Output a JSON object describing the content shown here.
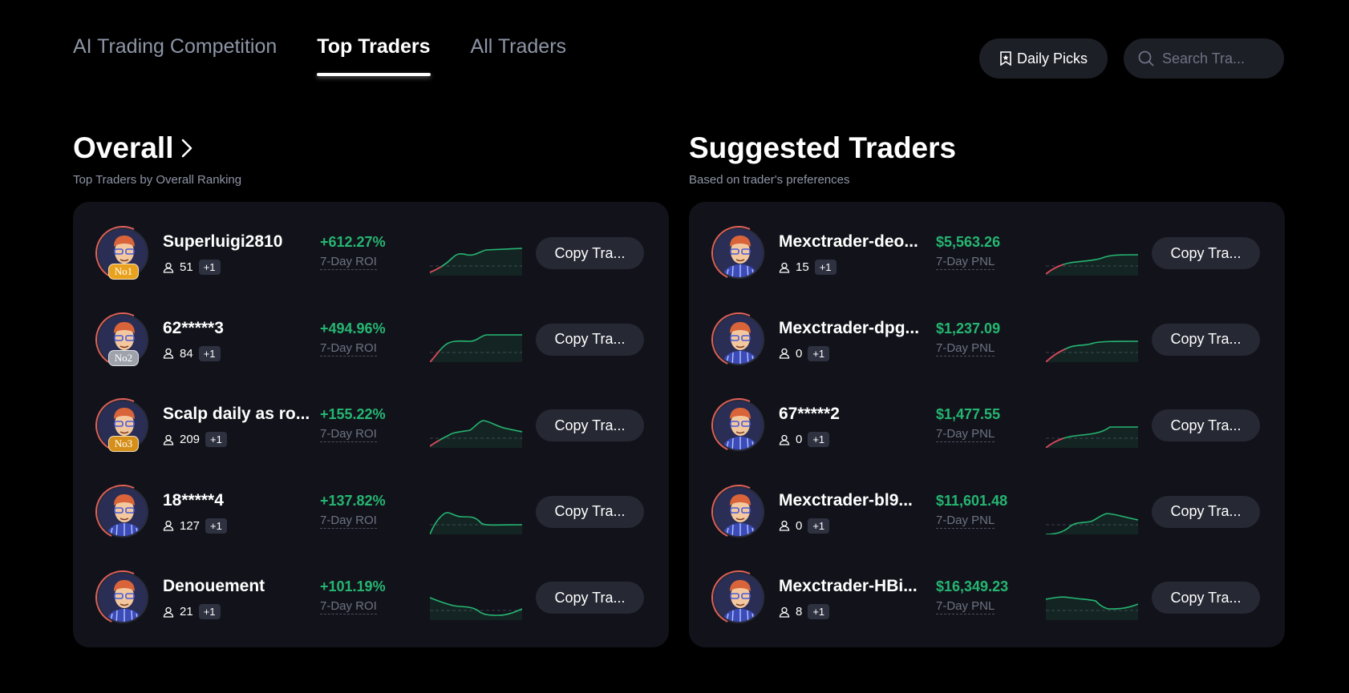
{
  "tabs": [
    {
      "label": "AI Trading Competition"
    },
    {
      "label": "Top Traders"
    },
    {
      "label": "All Traders"
    }
  ],
  "header": {
    "daily_picks_label": "Daily Picks",
    "search_placeholder": "Search Tra..."
  },
  "overall": {
    "title": "Overall",
    "subtitle": "Top Traders by Overall Ranking",
    "traders": [
      {
        "name": "Superluigi2810",
        "followers": "51",
        "extra": "+1",
        "value": "+612.27%",
        "metric_label": "7-Day ROI",
        "rank": "No1",
        "copy_label": "Copy Tra..."
      },
      {
        "name": "62*****3",
        "followers": "84",
        "extra": "+1",
        "value": "+494.96%",
        "metric_label": "7-Day ROI",
        "rank": "No2",
        "copy_label": "Copy Tra..."
      },
      {
        "name": "Scalp daily as ro...",
        "followers": "209",
        "extra": "+1",
        "value": "+155.22%",
        "metric_label": "7-Day ROI",
        "rank": "No3",
        "copy_label": "Copy Tra..."
      },
      {
        "name": "18*****4",
        "followers": "127",
        "extra": "+1",
        "value": "+137.82%",
        "metric_label": "7-Day ROI",
        "copy_label": "Copy Tra..."
      },
      {
        "name": "Denouement",
        "followers": "21",
        "extra": "+1",
        "value": "+101.19%",
        "metric_label": "7-Day ROI",
        "copy_label": "Copy Tra..."
      }
    ]
  },
  "suggested": {
    "title": "Suggested Traders",
    "subtitle": "Based on trader's preferences",
    "traders": [
      {
        "name": "Mexctrader-deo...",
        "followers": "15",
        "extra": "+1",
        "value": "$5,563.26",
        "metric_label": "7-Day PNL",
        "copy_label": "Copy Tra..."
      },
      {
        "name": "Mexctrader-dpg...",
        "followers": "0",
        "extra": "+1",
        "value": "$1,237.09",
        "metric_label": "7-Day PNL",
        "copy_label": "Copy Tra..."
      },
      {
        "name": "67*****2",
        "followers": "0",
        "extra": "+1",
        "value": "$1,477.55",
        "metric_label": "7-Day PNL",
        "copy_label": "Copy Tra..."
      },
      {
        "name": "Mexctrader-bl9...",
        "followers": "0",
        "extra": "+1",
        "value": "$11,601.48",
        "metric_label": "7-Day PNL",
        "copy_label": "Copy Tra..."
      },
      {
        "name": "Mexctrader-HBi...",
        "followers": "8",
        "extra": "+1",
        "value": "$16,349.23",
        "metric_label": "7-Day PNL",
        "copy_label": "Copy Tra..."
      }
    ]
  },
  "colors": {
    "positive": "#25b672",
    "negative": "#e0455c",
    "background": "#000000",
    "panel": "#12131a"
  }
}
